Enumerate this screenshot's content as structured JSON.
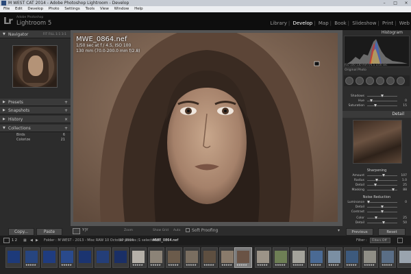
{
  "window": {
    "title": "M WEST CAT 2014 - Adobe Photoshop Lightroom - Develop",
    "controls": [
      "–",
      "□",
      "×"
    ]
  },
  "menu": [
    "File",
    "Edit",
    "Develop",
    "Photo",
    "Settings",
    "Tools",
    "View",
    "Window",
    "Help"
  ],
  "app": {
    "logo": "Lr",
    "brand_small": "Adobe Photoshop",
    "brand": "Lightroom 5"
  },
  "modules": [
    "Library",
    "Develop",
    "Map",
    "Book",
    "Slideshow",
    "Print",
    "Web"
  ],
  "active_module": "Develop",
  "left": {
    "navigator": {
      "title": "Navigator",
      "options": "FIT  FILL  1:1  3:1"
    },
    "panels": [
      "Presets",
      "Snapshots",
      "History",
      "Collections"
    ],
    "collections": [
      {
        "name": "Birds",
        "count": "6"
      },
      {
        "name": "Colorize",
        "count": "21"
      }
    ],
    "copy": "Copy...",
    "paste": "Paste"
  },
  "photo": {
    "filename": "MWE_0864.nef",
    "line1": "1/50 sec at f / 4.5, ISO 100",
    "line2": "130 mm (70.0-200.0 mm f/2.8)"
  },
  "toolbar": {
    "before_after": "Y|Y",
    "soft_proofing": "Soft Proofing",
    "zoom": "Zoom",
    "show_grid": "Show Grid",
    "auto": "Auto"
  },
  "right": {
    "histogram": "Histogram",
    "histo_info": "ISO 100   130 mm   f/4.5   1/50 sec",
    "original_photo": "Original Photo",
    "shadows_group": [
      {
        "label": "Shadows",
        "value": ""
      },
      {
        "label": "Hue",
        "value": "0"
      },
      {
        "label": "Saturation",
        "value": "15"
      }
    ],
    "detail": "Detail",
    "sharpening": "Sharpening",
    "sharpen": [
      {
        "label": "Amount",
        "value": "107"
      },
      {
        "label": "Radius",
        "value": "1.0"
      },
      {
        "label": "Detail",
        "value": "25"
      },
      {
        "label": "Masking",
        "value": "88"
      }
    ],
    "noise": "Noise Reduction",
    "noise_rows": [
      {
        "label": "Luminance",
        "value": "0"
      },
      {
        "label": "Detail",
        "value": ""
      },
      {
        "label": "Contrast",
        "value": ""
      },
      {
        "label": "Color",
        "value": "25"
      },
      {
        "label": "Detail",
        "value": "50"
      }
    ],
    "previous": "Previous",
    "reset": "Reset"
  },
  "filmbar": {
    "pages": "1  2",
    "path": "Folder : M WEST - 2013 - Misc RAW 10 October 2014",
    "count": "37 photos /1 selected /",
    "selected": "MWE_0864.nef",
    "filter": "Filter :",
    "filter_value": "Filters Off"
  },
  "filmstrip": {
    "stars": "★★★★★"
  }
}
